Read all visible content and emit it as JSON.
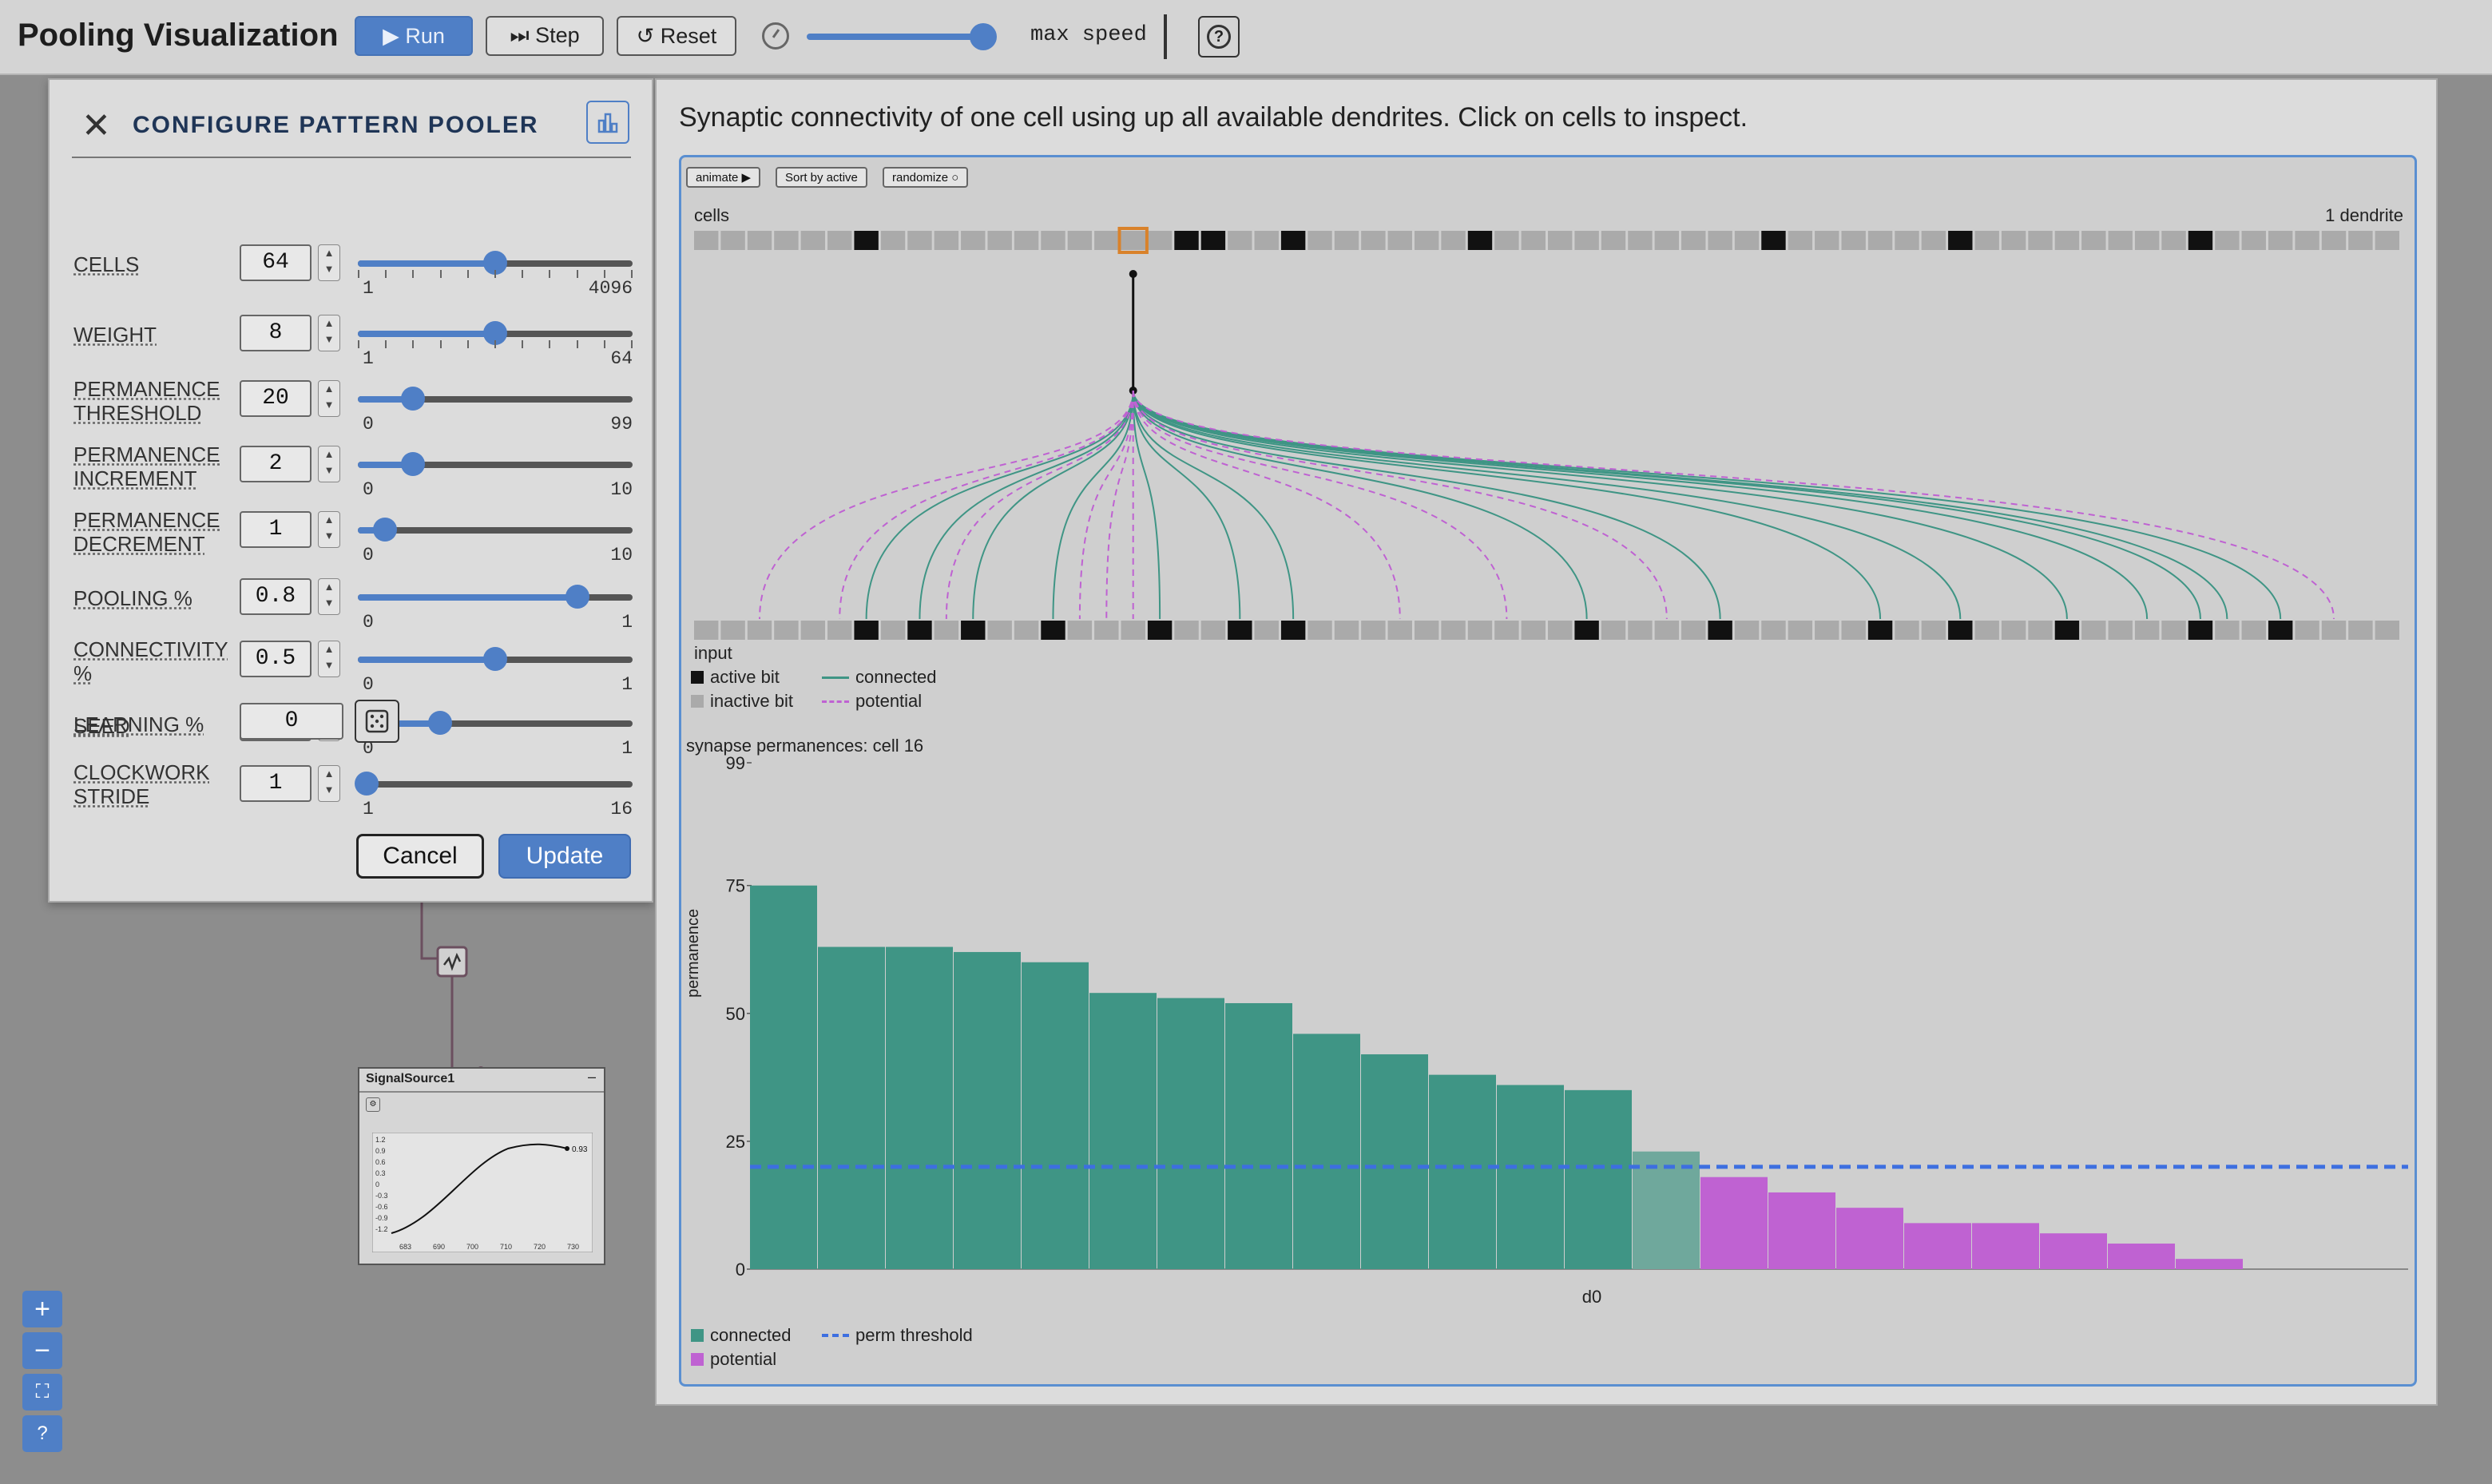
{
  "app": {
    "title": "Pooling Visualization"
  },
  "toolbar": {
    "run_label": "▶ Run",
    "step_label": "⏭ Step",
    "reset_label": "↺ Reset",
    "speed_label": "max speed",
    "speed_level": 1.0
  },
  "config": {
    "title": "CONFIGURE PATTERN POOLER",
    "params": [
      {
        "label": "CELLS",
        "value": "64",
        "min": "1",
        "max": "4096",
        "fraction": 0.5,
        "ticks": true
      },
      {
        "label": "WEIGHT",
        "value": "8",
        "min": "1",
        "max": "64",
        "fraction": 0.5,
        "ticks": true
      },
      {
        "label": "PERMANENCE THRESHOLD",
        "value": "20",
        "min": "0",
        "max": "99",
        "fraction": 0.2
      },
      {
        "label": "PERMANENCE INCREMENT",
        "value": "2",
        "min": "0",
        "max": "10",
        "fraction": 0.2
      },
      {
        "label": "PERMANENCE DECREMENT",
        "value": "1",
        "min": "0",
        "max": "10",
        "fraction": 0.1
      },
      {
        "label": "POOLING %",
        "value": "0.8",
        "min": "0",
        "max": "1",
        "fraction": 0.8
      },
      {
        "label": "CONNECTIVITY %",
        "value": "0.5",
        "min": "0",
        "max": "1",
        "fraction": 0.5
      },
      {
        "label": "LEARNING %",
        "value": "0.3",
        "min": "0",
        "max": "1",
        "fraction": 0.3
      }
    ],
    "seed": {
      "label": "SEED",
      "value": "0"
    },
    "stride": {
      "label": "CLOCKWORK STRIDE",
      "value": "1",
      "min": "1",
      "max": "16",
      "fraction": 0.0
    },
    "cancel_label": "Cancel",
    "update_label": "Update"
  },
  "signal_node": {
    "title": "SignalSource1",
    "value_label": "0.93",
    "x_ticks": [
      "683",
      "690",
      "700",
      "710",
      "720",
      "730"
    ],
    "y_ticks": [
      "1.2",
      "0.9",
      "0.6",
      "0.3",
      "0",
      "-0.3",
      "-0.6",
      "-0.9",
      "-1.2"
    ]
  },
  "viz": {
    "caption": "Synaptic connectivity of one cell using up all available dendrites. Click on cells to inspect.",
    "buttons": {
      "animate": "animate ▶",
      "sort": "Sort by active",
      "randomize": "randomize ○"
    },
    "cells_label": "cells",
    "dendrite_label": "1 dendrite",
    "input_label": "input",
    "legend": {
      "active": "active bit",
      "inactive": "inactive bit",
      "connected": "connected",
      "potential": "potential"
    },
    "cell_count": 64,
    "active_cells": [
      6,
      18,
      19,
      22,
      29,
      40,
      47,
      56
    ],
    "selected_cell": 16,
    "input_active": [
      6,
      8,
      10,
      13,
      17,
      20,
      22,
      33,
      38,
      44,
      47,
      51,
      56,
      59
    ],
    "connected_inputs": [
      6,
      8,
      10,
      13,
      17,
      20,
      22,
      33,
      38,
      44,
      47,
      51,
      56,
      59,
      54,
      57
    ],
    "potential_inputs": [
      2,
      5,
      9,
      14,
      15,
      16,
      26,
      30,
      36,
      61
    ],
    "colors": {
      "connected": "#3f9585",
      "potential": "#bf62d2",
      "threshold": "#3d6fe0",
      "active": "#111111",
      "inactive": "#aaaaaa",
      "selected": "#d9822b"
    }
  },
  "chart_data": {
    "type": "bar",
    "title": "synapse permanences: cell 16",
    "xlabel": "d0",
    "ylabel": "permanence",
    "ylim": [
      0,
      99
    ],
    "yticks": [
      0,
      25,
      50,
      75,
      99
    ],
    "threshold": 20,
    "series": [
      {
        "name": "connected",
        "values": [
          75,
          63,
          63,
          62,
          60,
          54,
          53,
          52,
          46,
          42,
          38,
          36,
          35,
          23
        ]
      },
      {
        "name": "potential",
        "values": [
          18,
          15,
          12,
          9,
          9,
          7,
          5,
          2
        ]
      }
    ],
    "legend": {
      "connected": "connected",
      "potential": "potential",
      "threshold": "perm threshold"
    }
  }
}
